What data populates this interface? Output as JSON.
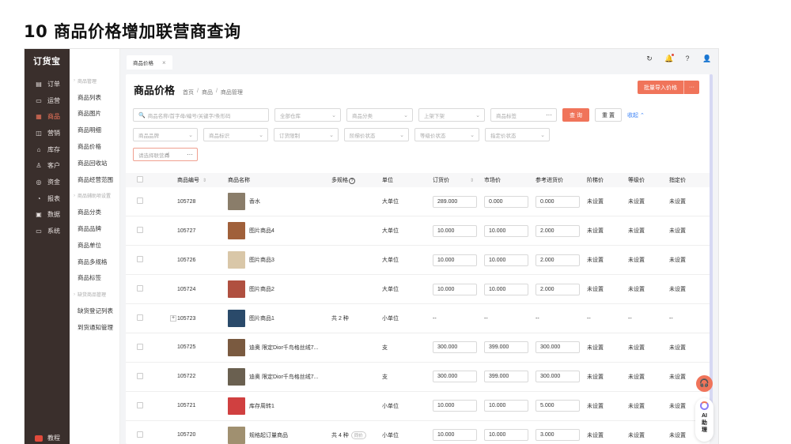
{
  "slide_title": "10 商品价格增加联营商查询",
  "app": {
    "logo": "订货宝",
    "main_nav": [
      {
        "icon": "▤",
        "label": "订单",
        "active": false
      },
      {
        "icon": "▭",
        "label": "运营",
        "active": false
      },
      {
        "icon": "▦",
        "label": "商品",
        "active": true
      },
      {
        "icon": "◫",
        "label": "营销",
        "active": false
      },
      {
        "icon": "⌂",
        "label": "库存",
        "active": false
      },
      {
        "icon": "♙",
        "label": "客户",
        "active": false
      },
      {
        "icon": "◎",
        "label": "资金",
        "active": false
      },
      {
        "icon": "◔",
        "label": "报表",
        "active": false
      },
      {
        "icon": "▣",
        "label": "数据",
        "active": false
      },
      {
        "icon": "▭",
        "label": "系统",
        "active": false
      }
    ],
    "tutorial_label": "教程",
    "sub_nav": [
      {
        "label": "商品管理",
        "group": true
      },
      {
        "label": "商品列表",
        "group": false
      },
      {
        "label": "商品图片",
        "group": false
      },
      {
        "label": "商品明细",
        "group": false
      },
      {
        "label": "商品价格",
        "group": false
      },
      {
        "label": "商品回收站",
        "group": false
      },
      {
        "label": "商品经营范围",
        "group": false
      },
      {
        "label": "商品辅助项设置",
        "group": true
      },
      {
        "label": "商品分类",
        "group": false
      },
      {
        "label": "商品品牌",
        "group": false
      },
      {
        "label": "商品单位",
        "group": false
      },
      {
        "label": "商品多规格",
        "group": false
      },
      {
        "label": "商品标签",
        "group": false
      },
      {
        "label": "缺货商品管理",
        "group": true
      },
      {
        "label": "缺货登记列表",
        "group": false
      },
      {
        "label": "到货通知管理",
        "group": false
      }
    ],
    "tab_label": "商品价格",
    "tab_close": "×",
    "top_icons": [
      "↻",
      "🔔",
      "?",
      "👤"
    ]
  },
  "page": {
    "title": "商品价格",
    "breadcrumb": [
      "首页",
      "商品",
      "商品管理"
    ],
    "breadcrumb_sep": "/",
    "import_label": "批量导入价格",
    "import_more": "···"
  },
  "filters": {
    "search_placeholder": "商品名称/首字母/编号/关键字/条形码",
    "row1_selects": [
      "全部仓库",
      "商品分类",
      "上架下架"
    ],
    "tag_placeholder": "商品标签",
    "query_label": "查 询",
    "reset_label": "重 置",
    "collapse_label": "收起",
    "row2_selects": [
      "商品品牌",
      "商品标识",
      "订货限制",
      "阶梯价状态",
      "等级价状态",
      "指定价状态"
    ],
    "union_placeholder": "请选择联营商",
    "dots": "···"
  },
  "table": {
    "columns": [
      "商品编号",
      "商品名称",
      "多规格",
      "单位",
      "订货价",
      "市场价",
      "参考进货价",
      "阶梯价",
      "等级价",
      "指定价"
    ],
    "not_set": "未设置",
    "empty": "--",
    "rows": [
      {
        "code": "105728",
        "name": "香水",
        "spec": "",
        "spec_badge": "",
        "unit": "大单位",
        "order_price": "289.000",
        "market_price": "0.000",
        "ref_price": "0.000",
        "expandable": false,
        "thumb": "#8a7d6a"
      },
      {
        "code": "105727",
        "name": "图片商品4",
        "spec": "",
        "spec_badge": "",
        "unit": "大单位",
        "order_price": "10.000",
        "market_price": "10.000",
        "ref_price": "2.000",
        "expandable": false,
        "thumb": "#a0603a"
      },
      {
        "code": "105726",
        "name": "图片商品3",
        "spec": "",
        "spec_badge": "",
        "unit": "大单位",
        "order_price": "10.000",
        "market_price": "10.000",
        "ref_price": "2.000",
        "expandable": false,
        "thumb": "#d9c7a8"
      },
      {
        "code": "105724",
        "name": "图片商品2",
        "spec": "",
        "spec_badge": "",
        "unit": "大单位",
        "order_price": "10.000",
        "market_price": "10.000",
        "ref_price": "2.000",
        "expandable": false,
        "thumb": "#b05040"
      },
      {
        "code": "105723",
        "name": "图片商品1",
        "spec": "共 2 种",
        "spec_badge": "",
        "unit": "小单位",
        "order_price": "",
        "market_price": "",
        "ref_price": "",
        "expandable": true,
        "thumb": "#2a4a6a"
      },
      {
        "code": "105725",
        "name": "迪奥 限定Dior千鸟格丝绒7...",
        "spec": "",
        "spec_badge": "",
        "unit": "支",
        "order_price": "300.000",
        "market_price": "399.000",
        "ref_price": "300.000",
        "expandable": false,
        "thumb": "#7a5a40"
      },
      {
        "code": "105722",
        "name": "迪奥 限定Dior千鸟格丝绒7...",
        "spec": "",
        "spec_badge": "",
        "unit": "支",
        "order_price": "300.000",
        "market_price": "399.000",
        "ref_price": "300.000",
        "expandable": false,
        "thumb": "#6a6050"
      },
      {
        "code": "105721",
        "name": "库存周转1",
        "spec": "",
        "spec_badge": "",
        "unit": "小单位",
        "order_price": "10.000",
        "market_price": "10.000",
        "ref_price": "5.000",
        "expandable": false,
        "thumb": "#d04040"
      },
      {
        "code": "105720",
        "name": "规格起订量商品",
        "spec": "共 4 种",
        "spec_badge": "同价",
        "unit": "小单位",
        "order_price": "10.000",
        "market_price": "10.000",
        "ref_price": "3.000",
        "expandable": false,
        "thumb": "#a09070"
      }
    ]
  },
  "floating": {
    "headset_icon": "🎧",
    "ai_label": [
      "AI",
      "助",
      "理"
    ]
  },
  "colors": {
    "accent": "#f0745a",
    "sidebar": "#3a2f2c",
    "link": "#3b82f6"
  }
}
